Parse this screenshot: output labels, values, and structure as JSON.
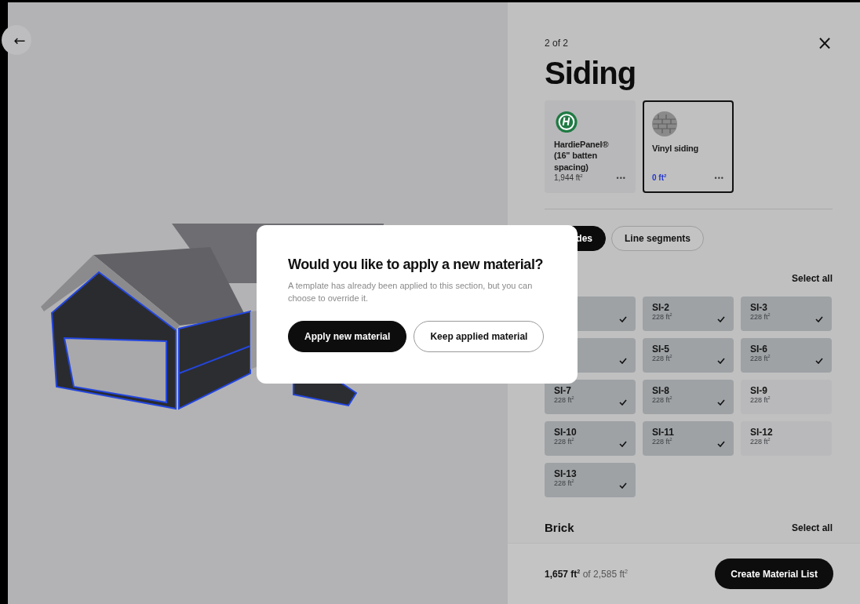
{
  "viewport": {
    "back_button": "←"
  },
  "panel": {
    "step": "2 of 2",
    "title": "Siding",
    "close": "×",
    "materials": [
      {
        "kind": "brand",
        "name": "HardiePanel® (16\" batten spacing)",
        "area": "1,944 ft$^{2}$",
        "selected": false,
        "more": "•••"
      },
      {
        "kind": "texture",
        "name": "Vinyl siding",
        "area": "0 ft$^{2}$",
        "selected": true,
        "more": "•••"
      }
    ],
    "tabs": [
      {
        "label": "des",
        "selected": true
      },
      {
        "label": "Line segments",
        "selected": false
      }
    ],
    "sections": [
      {
        "select_all": "Select all",
        "tiles": [
          {
            "checked": true
          },
          {
            "name": "SI-2",
            "area": "228 ft$^{2}$",
            "checked": true
          },
          {
            "name": "SI-3",
            "area": "228 ft$^{2}$",
            "checked": true
          },
          {
            "checked": true
          },
          {
            "name": "SI-5",
            "area": "228 ft$^{2}$",
            "checked": true
          },
          {
            "name": "SI-6",
            "area": "228 ft$^{2}$",
            "checked": true
          },
          {
            "name": "SI-7",
            "area": "228 ft$^{2}$",
            "checked": true
          },
          {
            "name": "SI-8",
            "area": "228 ft$^{2}$",
            "checked": true
          },
          {
            "name": "SI-9",
            "area": "228 ft$^{2}$",
            "checked": false
          },
          {
            "name": "SI-10",
            "area": "228 ft$^{2}$",
            "checked": true
          },
          {
            "name": "SI-11",
            "area": "228 ft$^{2}$",
            "checked": true
          },
          {
            "name": "SI-12",
            "area": "228 ft$^{2}$",
            "checked": false
          },
          {
            "name": "SI-13",
            "area": "228 ft$^{2}$",
            "checked": true
          }
        ]
      },
      {
        "title": "Brick",
        "select_all": "Select all"
      }
    ],
    "footer": {
      "summary": "**1,657 ft$^{2}$** of 2,585 ft$^{2}$",
      "button": "Create Material List"
    }
  },
  "dialog": {
    "title": "Would you like to apply a new material?",
    "message": "A template has already been applied to this section, but you can choose to override it.",
    "buttons": [
      {
        "kind": "primary",
        "label": "Apply new material"
      },
      {
        "kind": "secondary",
        "label": "Keep applied material"
      }
    ]
  }
}
